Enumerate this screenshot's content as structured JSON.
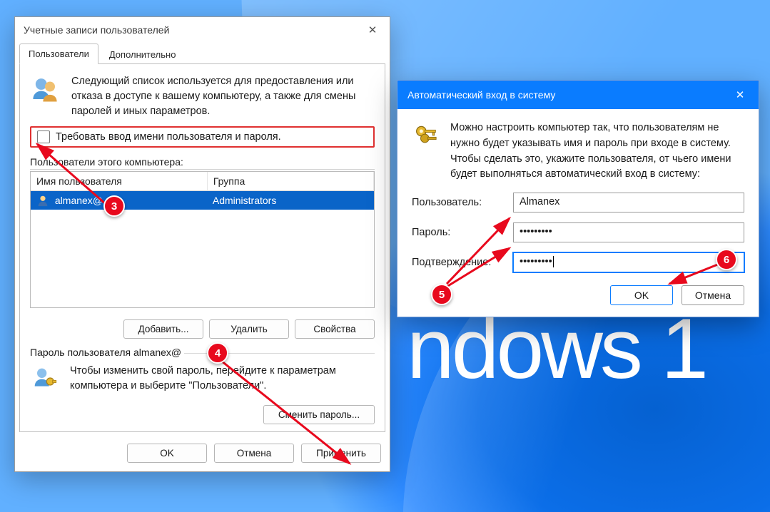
{
  "bg_text": "ndows 1",
  "win1": {
    "title": "Учетные записи пользователей",
    "tabs": {
      "users": "Пользователи",
      "advanced": "Дополнительно"
    },
    "desc": "Следующий список используется для предоставления или отказа в доступе к вашему компьютеру, а также для смены паролей и иных параметров.",
    "checkbox_label": "Требовать ввод имени пользователя и пароля.",
    "users_section": "Пользователи этого компьютера:",
    "col_user": "Имя пользователя",
    "col_group": "Группа",
    "row_user": "almanex@",
    "row_group": "Administrators",
    "btn_add": "Добавить...",
    "btn_del": "Удалить",
    "btn_props": "Свойства",
    "pwd_legend": "Пароль пользователя almanex@",
    "pwd_desc": "Чтобы изменить свой пароль, перейдите к параметрам компьютера и выберите \"Пользователи\".",
    "btn_change_pwd": "Сменить пароль...",
    "btn_ok": "OK",
    "btn_cancel": "Отмена",
    "btn_apply": "Применить"
  },
  "dlg": {
    "title": "Автоматический вход в систему",
    "desc": "Можно настроить компьютер так, что пользователям не нужно будет указывать имя и пароль при входе в систему. Чтобы сделать это, укажите пользователя, от чьего имени будет выполняться автоматический вход в систему:",
    "user_label": "Пользователь:",
    "user_value": "Almanex",
    "pwd_label": "Пароль:",
    "pwd_value": "•••••••••",
    "confirm_label": "Подтверждение:",
    "confirm_value": "•••••••••",
    "btn_ok": "OK",
    "btn_cancel": "Отмена"
  },
  "badges": {
    "b3": "3",
    "b4": "4",
    "b5": "5",
    "b6": "6"
  }
}
